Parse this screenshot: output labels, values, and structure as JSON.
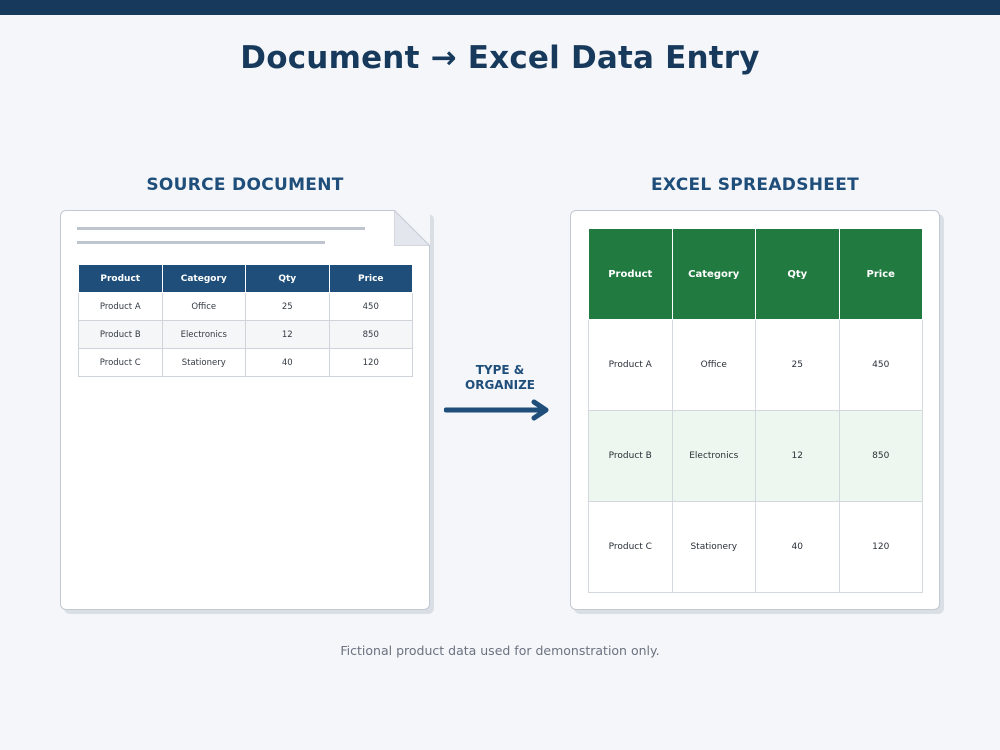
{
  "title": "Document → Excel Data Entry",
  "source": {
    "heading": "SOURCE DOCUMENT",
    "table": {
      "columns": [
        "Product",
        "Category",
        "Qty",
        "Price"
      ],
      "rows": [
        [
          "Product A",
          "Office",
          "25",
          "450"
        ],
        [
          "Product B",
          "Electronics",
          "12",
          "850"
        ],
        [
          "Product C",
          "Stationery",
          "40",
          "120"
        ]
      ]
    }
  },
  "arrow": {
    "line1": "TYPE &",
    "line2": "ORGANIZE"
  },
  "spreadsheet": {
    "heading": "EXCEL SPREADSHEET",
    "table": {
      "columns": [
        "Product",
        "Category",
        "Qty",
        "Price"
      ],
      "rows": [
        [
          "Product A",
          "Office",
          "25",
          "450"
        ],
        [
          "Product B",
          "Electronics",
          "12",
          "850"
        ],
        [
          "Product C",
          "Stationery",
          "40",
          "120"
        ]
      ]
    }
  },
  "footnote": "Fictional product data used for demonstration only.",
  "colors": {
    "navy": "#173a5c",
    "doc_header": "#1f4e7a",
    "excel_green": "#217a40",
    "excel_alt_row": "#edf6ef",
    "background": "#f4f6fa"
  },
  "icons": {
    "doc_corner": "page-fold-icon",
    "flow": "arrow-right-icon"
  }
}
